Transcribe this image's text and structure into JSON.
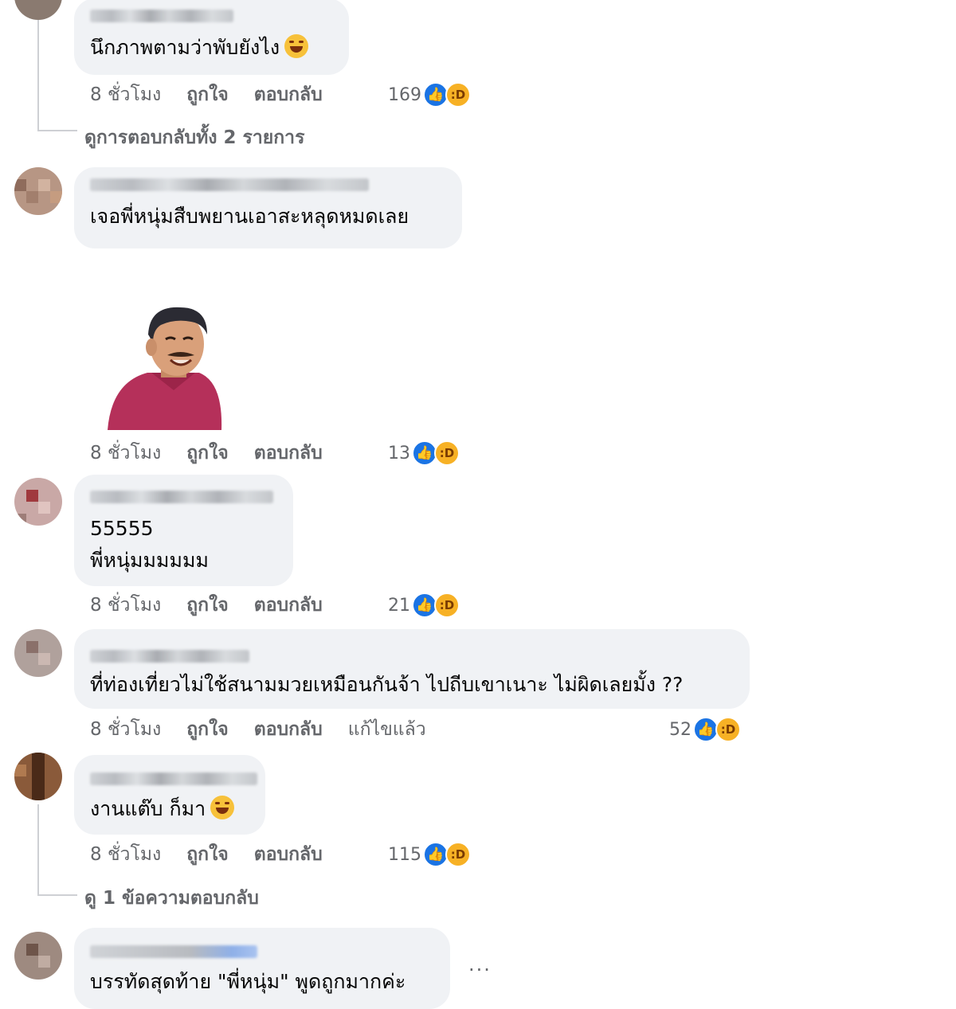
{
  "labels": {
    "time": "8 ชั่วโมง",
    "like": "ถูกใจ",
    "reply": "ตอบกลับ",
    "edited": "แก้ไขแล้ว"
  },
  "reaction_icons": [
    "like-icon",
    "haha-icon"
  ],
  "colors": {
    "bubble": "#f0f2f5",
    "meta_text": "#65676b",
    "like_blue": "#1b74e4",
    "haha_yellow": "#f7b125"
  },
  "comments": [
    {
      "text": "นึกภาพตามว่าพับยังไง",
      "emoji": "haha-emoji",
      "reactions": "169",
      "view_replies": "ดูการตอบกลับทั้ง 2 รายการ"
    },
    {
      "text": "เจอพี่หนุ่มสืบพยานเอาสะหลุดหมดเลย",
      "sticker": "laughing-man-sticker",
      "reactions": "13"
    },
    {
      "lines": [
        "55555",
        "พี่หนุ่มมมมมม"
      ],
      "reactions": "21"
    },
    {
      "text": "ที่ท่องเที่ยวไม่ใช้สนามมวยเหมือนกันจ้า ไปถีบเขาเนาะ ไม่ผิดเลยมั้ง ??",
      "edited": true,
      "reactions": "52"
    },
    {
      "text": "งานแต๊บ ก็มา",
      "emoji": "haha-emoji",
      "reactions": "115",
      "view_replies": "ดู 1 ข้อความตอบกลับ"
    },
    {
      "text": "บรรทัดสุดท้าย \"พี่หนุ่ม\" พูดถูกมากค่ะ",
      "more": "..."
    }
  ]
}
